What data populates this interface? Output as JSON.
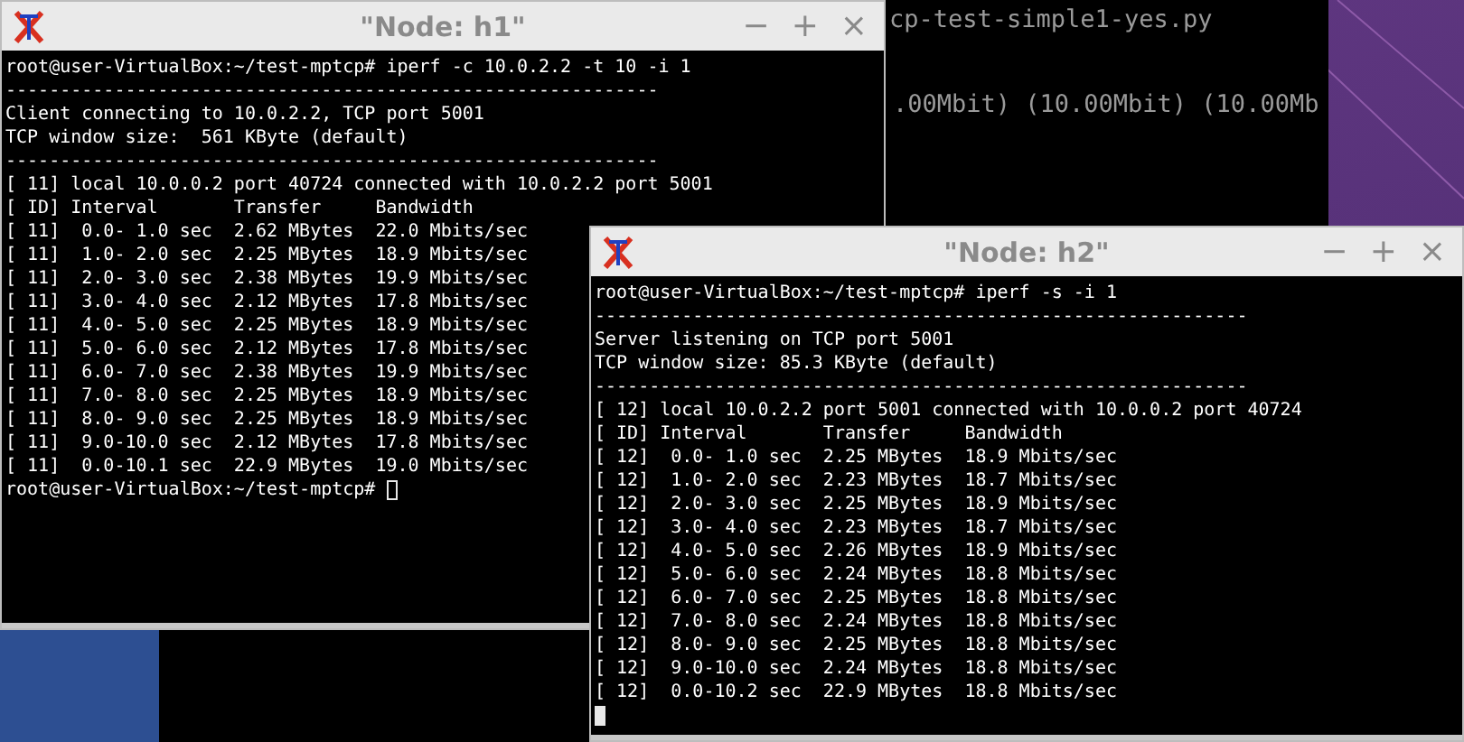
{
  "background_terminal": {
    "lines": [
      "cp-test-simple1-yes.py",
      ".00Mbit) (10.00Mbit) (10.00Mb"
    ]
  },
  "windows": [
    {
      "title": "\"Node: h1\"",
      "controls": [
        "−",
        "+",
        "×"
      ],
      "focused": false,
      "prompt": "root@user-VirtualBox:~/test-mptcp#",
      "lines": [
        "root@user-VirtualBox:~/test-mptcp# iperf -c 10.0.2.2 -t 10 -i 1",
        "------------------------------------------------------------",
        "Client connecting to 10.0.2.2, TCP port 5001",
        "TCP window size:  561 KByte (default)",
        "------------------------------------------------------------",
        "[ 11] local 10.0.0.2 port 40724 connected with 10.0.2.2 port 5001",
        "[ ID] Interval       Transfer     Bandwidth",
        "[ 11]  0.0- 1.0 sec  2.62 MBytes  22.0 Mbits/sec",
        "[ 11]  1.0- 2.0 sec  2.25 MBytes  18.9 Mbits/sec",
        "[ 11]  2.0- 3.0 sec  2.38 MBytes  19.9 Mbits/sec",
        "[ 11]  3.0- 4.0 sec  2.12 MBytes  17.8 Mbits/sec",
        "[ 11]  4.0- 5.0 sec  2.25 MBytes  18.9 Mbits/sec",
        "[ 11]  5.0- 6.0 sec  2.12 MBytes  17.8 Mbits/sec",
        "[ 11]  6.0- 7.0 sec  2.38 MBytes  19.9 Mbits/sec",
        "[ 11]  7.0- 8.0 sec  2.25 MBytes  18.9 Mbits/sec",
        "[ 11]  8.0- 9.0 sec  2.25 MBytes  18.9 Mbits/sec",
        "[ 11]  9.0-10.0 sec  2.12 MBytes  17.8 Mbits/sec",
        "[ 11]  0.0-10.1 sec  22.9 MBytes  19.0 Mbits/sec"
      ]
    },
    {
      "title": "\"Node: h2\"",
      "controls": [
        "−",
        "+",
        "×"
      ],
      "focused": true,
      "lines": [
        "root@user-VirtualBox:~/test-mptcp# iperf -s -i 1",
        "------------------------------------------------------------",
        "Server listening on TCP port 5001",
        "TCP window size: 85.3 KByte (default)",
        "------------------------------------------------------------",
        "[ 12] local 10.0.2.2 port 5001 connected with 10.0.0.2 port 40724",
        "[ ID] Interval       Transfer     Bandwidth",
        "[ 12]  0.0- 1.0 sec  2.25 MBytes  18.9 Mbits/sec",
        "[ 12]  1.0- 2.0 sec  2.23 MBytes  18.7 Mbits/sec",
        "[ 12]  2.0- 3.0 sec  2.25 MBytes  18.9 Mbits/sec",
        "[ 12]  3.0- 4.0 sec  2.23 MBytes  18.7 Mbits/sec",
        "[ 12]  4.0- 5.0 sec  2.26 MBytes  18.9 Mbits/sec",
        "[ 12]  5.0- 6.0 sec  2.24 MBytes  18.8 Mbits/sec",
        "[ 12]  6.0- 7.0 sec  2.25 MBytes  18.8 Mbits/sec",
        "[ 12]  7.0- 8.0 sec  2.24 MBytes  18.8 Mbits/sec",
        "[ 12]  8.0- 9.0 sec  2.25 MBytes  18.8 Mbits/sec",
        "[ 12]  9.0-10.0 sec  2.24 MBytes  18.8 Mbits/sec",
        "[ 12]  0.0-10.2 sec  22.9 MBytes  18.8 Mbits/sec"
      ]
    }
  ]
}
